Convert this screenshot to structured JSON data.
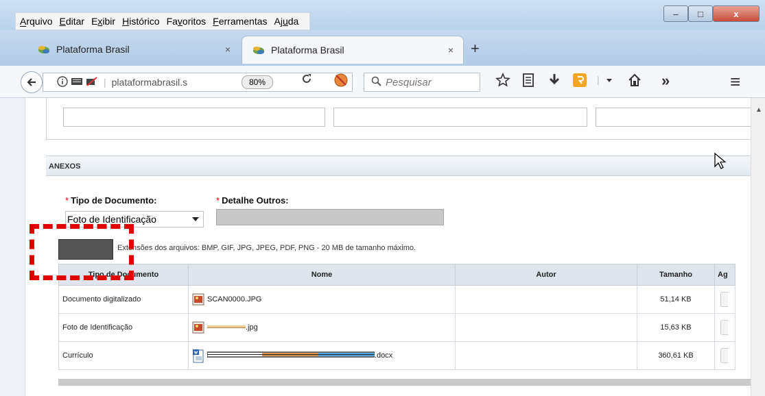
{
  "menu": [
    "Arquivo",
    "Editar",
    "Exibir",
    "Histórico",
    "Favoritos",
    "Ferramentas",
    "Ajuda"
  ],
  "menu_access_keys": [
    "A",
    "E",
    "x",
    "H",
    "v",
    "F",
    "u"
  ],
  "window_buttons": {
    "minimize": "–",
    "maximize": "□",
    "close": "x"
  },
  "tabs": [
    {
      "title": "Plataforma Brasil",
      "active": false,
      "close": "×"
    },
    {
      "title": "Plataforma Brasil",
      "active": true,
      "close": "×"
    }
  ],
  "new_tab": "+",
  "nav": {
    "url": "plataformabrasil.s",
    "zoom": "80%",
    "search_placeholder": "Pesquisar",
    "overflow": "»",
    "menu": "≡"
  },
  "section": {
    "title": "ANEXOS"
  },
  "form": {
    "tipo_label": "Tipo de Documento:",
    "tipo_value": "Foto de Identificação",
    "detalhe_label": "Detalhe Outros:",
    "required_mark": "*",
    "extensions_note": "Extensões dos arquivos: BMP, GIF, JPG, JPEG, PDF, PNG - 20 MB de tamanho máximo."
  },
  "table": {
    "headers": [
      "Tipo de Documento",
      "Nome",
      "Autor",
      "Tamanho",
      "Ag"
    ],
    "rows": [
      {
        "tipo": "Documento digitalizado",
        "nome": "SCAN0000.JPG",
        "autor": "",
        "tamanho": "51,14 KB"
      },
      {
        "tipo": "Foto de Identificação",
        "nome": ".jpg",
        "autor": "",
        "tamanho": "15,63 KB"
      },
      {
        "tipo": "Currículo",
        "nome": ".docx",
        "autor": "",
        "tamanho": "360,61 KB"
      }
    ]
  },
  "colors": {
    "accent_red": "#e00000",
    "header_bg": "#dfe5ec",
    "tab_bg": "#b3cbe6"
  },
  "icons": [
    "info-icon",
    "reader-icon",
    "no-video-icon",
    "reload-icon",
    "adblock-icon",
    "search-icon",
    "star-icon",
    "bookmarks-list-icon",
    "download-icon",
    "extension-icon",
    "dropdown-icon",
    "home-icon",
    "hamburger-icon",
    "file-image-icon",
    "file-word-icon",
    "cursor-icon"
  ]
}
